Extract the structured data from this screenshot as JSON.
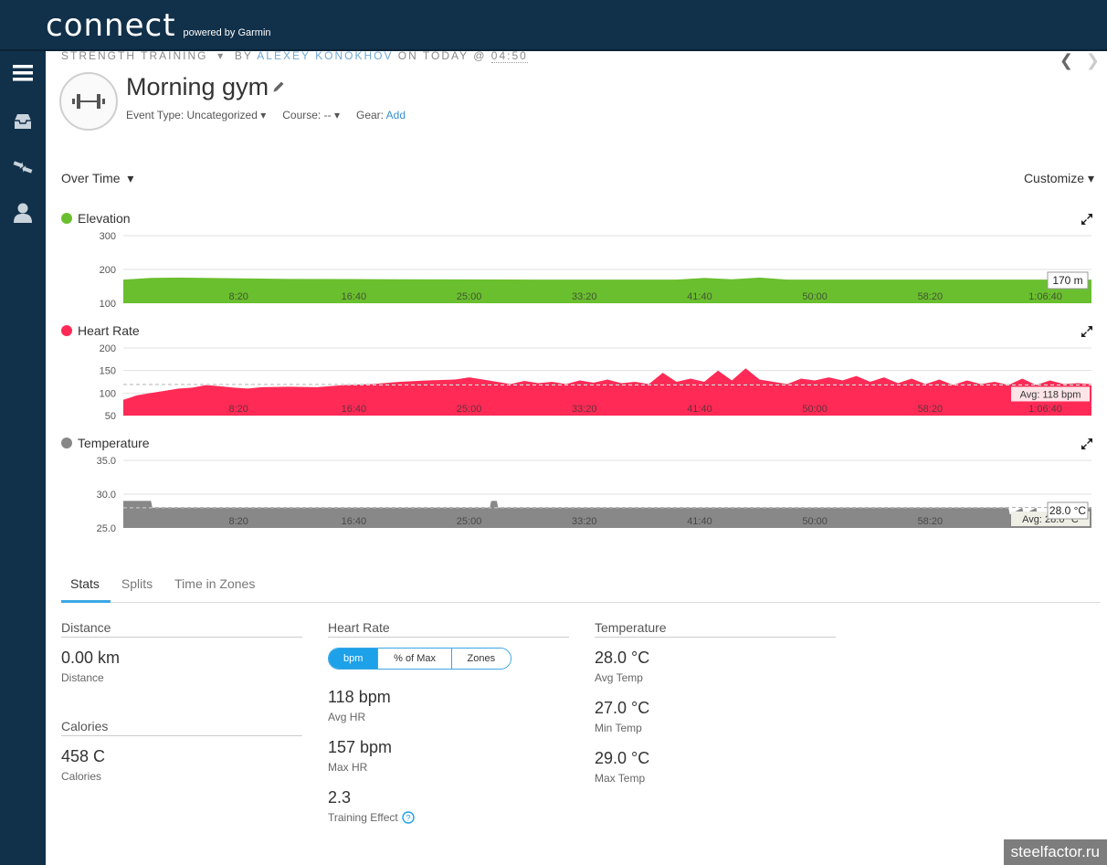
{
  "app": {
    "logo_main": "connect",
    "logo_sub": "powered by Garmin"
  },
  "sidebar": {
    "items": [
      {
        "name": "menu"
      },
      {
        "name": "inbox"
      },
      {
        "name": "connections"
      },
      {
        "name": "profile"
      }
    ]
  },
  "activity": {
    "type_label": "STRENGTH TRAINING",
    "by_label": "BY",
    "author": "ALEXEY KONOKHOV",
    "on_label": "ON TODAY @",
    "time": "04:50",
    "title": "Morning gym",
    "event_type_label": "Event Type:",
    "event_type_value": "Uncategorized",
    "course_label": "Course:",
    "course_value": "--",
    "gear_label": "Gear:",
    "gear_value": "Add"
  },
  "charts_header": {
    "view_label": "Over Time",
    "customize_label": "Customize"
  },
  "x_ticks": [
    "8:20",
    "16:40",
    "25:00",
    "33:20",
    "41:40",
    "50:00",
    "58:20",
    "1:06:40"
  ],
  "chart_data": [
    {
      "type": "area",
      "title": "Elevation",
      "color": "#6abf2e",
      "yticks": [
        "300",
        "200",
        "100"
      ],
      "ylim": [
        100,
        300
      ],
      "value_label": "170 m",
      "x_minutes": [
        0,
        2,
        4,
        8,
        12,
        20,
        30,
        40,
        42,
        44,
        46,
        48,
        50,
        60,
        70
      ],
      "values": [
        170,
        175,
        176,
        174,
        172,
        171,
        170,
        170,
        175,
        171,
        176,
        170,
        170,
        170,
        170
      ]
    },
    {
      "type": "area",
      "title": "Heart Rate",
      "color": "#ff2a56",
      "yticks": [
        "200",
        "150",
        "100",
        "50"
      ],
      "ylim": [
        50,
        200
      ],
      "avg_label": "Avg: 118 bpm",
      "avg_value": 118,
      "x_minutes": [
        0,
        1,
        2,
        3,
        4,
        5,
        6,
        7,
        8,
        9,
        10,
        12,
        14,
        16,
        18,
        20,
        22,
        24,
        25,
        26,
        27,
        28,
        29,
        30,
        31,
        32,
        33,
        34,
        35,
        36,
        37,
        38,
        39,
        40,
        41,
        42,
        43,
        44,
        45,
        46,
        47,
        48,
        49,
        50,
        51,
        52,
        53,
        54,
        55,
        56,
        57,
        58,
        59,
        60,
        61,
        62,
        63,
        64,
        65,
        66,
        67,
        68,
        69,
        70
      ],
      "values": [
        85,
        95,
        100,
        105,
        110,
        112,
        118,
        115,
        112,
        110,
        113,
        114,
        113,
        118,
        120,
        125,
        128,
        130,
        135,
        130,
        125,
        120,
        127,
        122,
        125,
        120,
        128,
        123,
        130,
        122,
        125,
        120,
        145,
        125,
        132,
        125,
        150,
        128,
        155,
        130,
        125,
        120,
        132,
        128,
        135,
        128,
        138,
        125,
        135,
        122,
        132,
        120,
        130,
        118,
        128,
        120,
        125,
        118,
        132,
        118,
        128,
        120,
        122,
        120
      ]
    },
    {
      "type": "area",
      "title": "Temperature",
      "color": "#888888",
      "yticks": [
        "35.0",
        "30.0",
        "25.0"
      ],
      "ylim": [
        25,
        35
      ],
      "value_label": "28.0 °C",
      "avg_label": "Avg: 28.0 °C",
      "avg_value": 28.0,
      "x_minutes": [
        0,
        2,
        2.1,
        26.5,
        26.6,
        27,
        27.1,
        60,
        64,
        64.1,
        65,
        65.1,
        66,
        66.1,
        70
      ],
      "values": [
        29.0,
        29.0,
        28.0,
        28.0,
        29.0,
        29.0,
        28.0,
        28.0,
        28.0,
        27.0,
        28.0,
        27.0,
        28.0,
        27.0,
        28.0
      ]
    }
  ],
  "tabs": [
    {
      "label": "Stats",
      "active": true
    },
    {
      "label": "Splits",
      "active": false
    },
    {
      "label": "Time in Zones",
      "active": false
    }
  ],
  "stats": {
    "distance": {
      "header": "Distance",
      "value": "0.00 km",
      "label": "Distance"
    },
    "calories": {
      "header": "Calories",
      "value": "458 C",
      "label": "Calories"
    },
    "heart_rate": {
      "header": "Heart Rate",
      "toggle": [
        "bpm",
        "% of Max",
        "Zones"
      ],
      "avg": {
        "value": "118 bpm",
        "label": "Avg HR"
      },
      "max": {
        "value": "157 bpm",
        "label": "Max HR"
      },
      "te": {
        "value": "2.3",
        "label": "Training Effect"
      }
    },
    "temperature": {
      "header": "Temperature",
      "avg": {
        "value": "28.0 °C",
        "label": "Avg Temp"
      },
      "min": {
        "value": "27.0 °C",
        "label": "Min Temp"
      },
      "max": {
        "value": "29.0 °C",
        "label": "Max Temp"
      }
    }
  },
  "watermark": "steelfactor.ru"
}
